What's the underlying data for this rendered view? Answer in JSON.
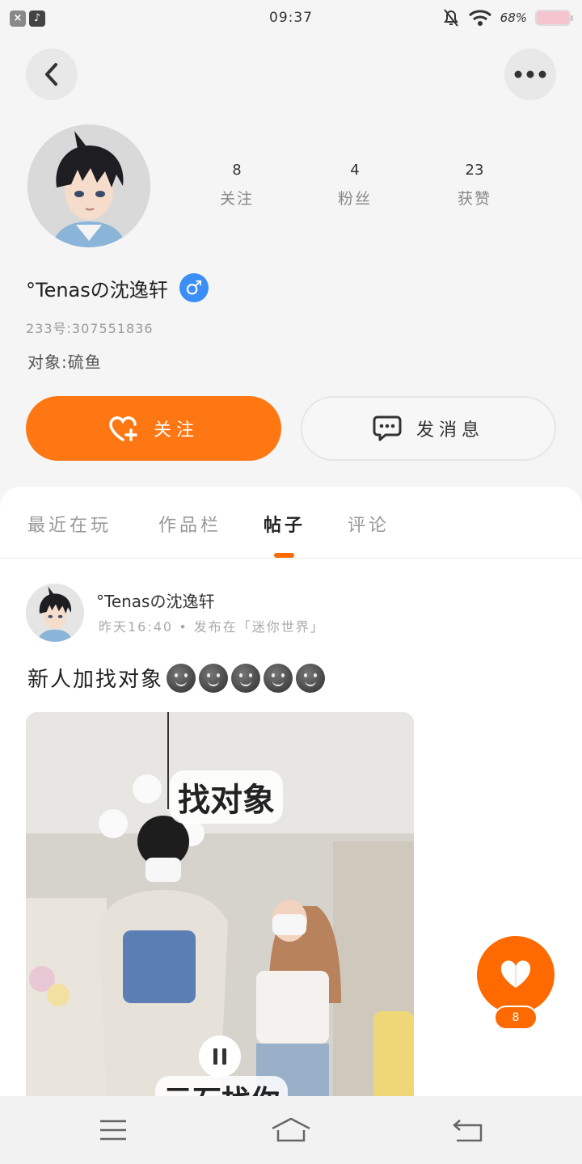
{
  "status_bar": {
    "time": "09:37",
    "battery": "68%"
  },
  "profile": {
    "name": "°Tenasの沈逸轩",
    "gender_symbol": "♂",
    "uid": "233号:307551836",
    "partner": "对象:硫鱼",
    "stats": [
      {
        "value": "8",
        "label": "关注"
      },
      {
        "value": "4",
        "label": "粉丝"
      },
      {
        "value": "23",
        "label": "获赞"
      }
    ]
  },
  "actions": {
    "follow_label": "关注",
    "message_label": "发消息"
  },
  "tabs": [
    {
      "label": "最近在玩",
      "active": false
    },
    {
      "label": "作品栏",
      "active": false
    },
    {
      "label": "帖子",
      "active": true
    },
    {
      "label": "评论",
      "active": false
    }
  ],
  "post": {
    "author": "°Tenasの沈逸轩",
    "meta": "昨天16:40 • 发布在「迷你世界」",
    "text": "新人加找对象",
    "emoji_count": 5,
    "video_caption_top": "找对象",
    "video_caption_bottom": "元石找你"
  },
  "like": {
    "count": "8"
  },
  "colors": {
    "accent": "#fe7713",
    "gender_blue": "#3a8ef6"
  }
}
